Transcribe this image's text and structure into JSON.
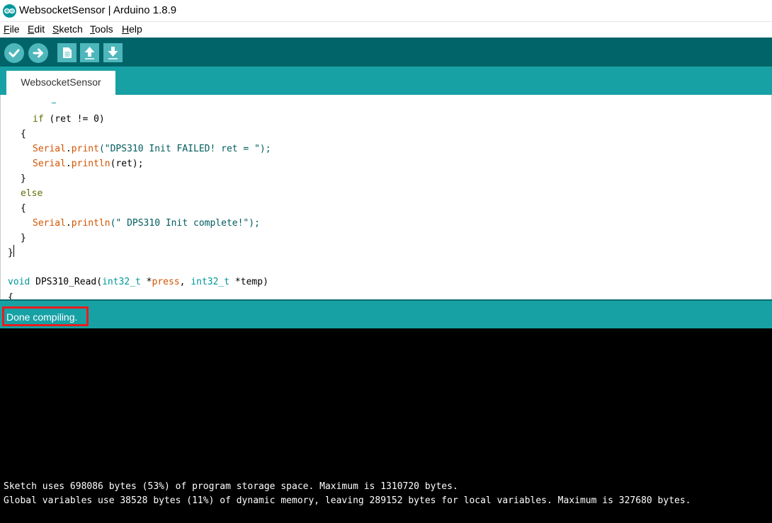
{
  "window": {
    "title": "WebsocketSensor | Arduino 1.8.9",
    "app_icon": "arduino-logo-icon"
  },
  "menu": {
    "items": [
      {
        "underline": "F",
        "rest": "ile"
      },
      {
        "underline": "E",
        "rest": "dit"
      },
      {
        "underline": "S",
        "rest": "ketch"
      },
      {
        "underline": "T",
        "rest": "ools"
      },
      {
        "underline": "H",
        "rest": "elp"
      }
    ]
  },
  "toolbar": {
    "buttons": [
      {
        "name": "verify",
        "icon": "checkmark-icon"
      },
      {
        "name": "upload",
        "icon": "arrow-right-icon"
      },
      {
        "name": "new",
        "icon": "new-file-icon"
      },
      {
        "name": "open",
        "icon": "arrow-up-icon"
      },
      {
        "name": "save",
        "icon": "arrow-down-icon"
      }
    ]
  },
  "tabs": [
    {
      "label": "WebsocketSensor"
    }
  ],
  "editor": {
    "lines": [
      {
        "t1": "if",
        "t2": " (ret != 0)"
      },
      {
        "t1": "{"
      },
      {
        "t1": "Serial",
        "t2": ".",
        "t3": "print",
        "t4": "(\"DPS310 Init FAILED! ret = \");"
      },
      {
        "t1": "Serial",
        "t2": ".",
        "t3": "println",
        "t4": "(ret);"
      },
      {
        "t1": "}"
      },
      {
        "t1": "else"
      },
      {
        "t1": "{"
      },
      {
        "t1": "Serial",
        "t2": ".",
        "t3": "println",
        "t4": "(\" DPS310 Init complete!\");"
      },
      {
        "t1": "}"
      },
      {
        "t1": "}"
      },
      {
        "t1": "void",
        "t2": " DPS310_Read(",
        "t3": "int32_t",
        "t4": " *",
        "t5": "press",
        "t6": ", ",
        "t7": "int32_t",
        "t8": " *temp)"
      },
      {
        "t1": "{"
      }
    ]
  },
  "status": {
    "message": "Done compiling."
  },
  "console": {
    "lines": [
      "Sketch uses 698086 bytes (53%) of program storage space. Maximum is 1310720 bytes.",
      "Global variables use 38528 bytes (11%) of dynamic memory, leaving 289152 bytes for local variables. Maximum is 327680 bytes."
    ]
  },
  "colors": {
    "toolbar_bg": "#006468",
    "tab_strip_bg": "#17a1a5",
    "button_bg": "#4db7bb",
    "keyword": "#5e6d03",
    "function": "#d35400",
    "type": "#00979c",
    "string": "#005c5f",
    "status_highlight": "#ea1c1c",
    "console_bg": "#000000"
  }
}
